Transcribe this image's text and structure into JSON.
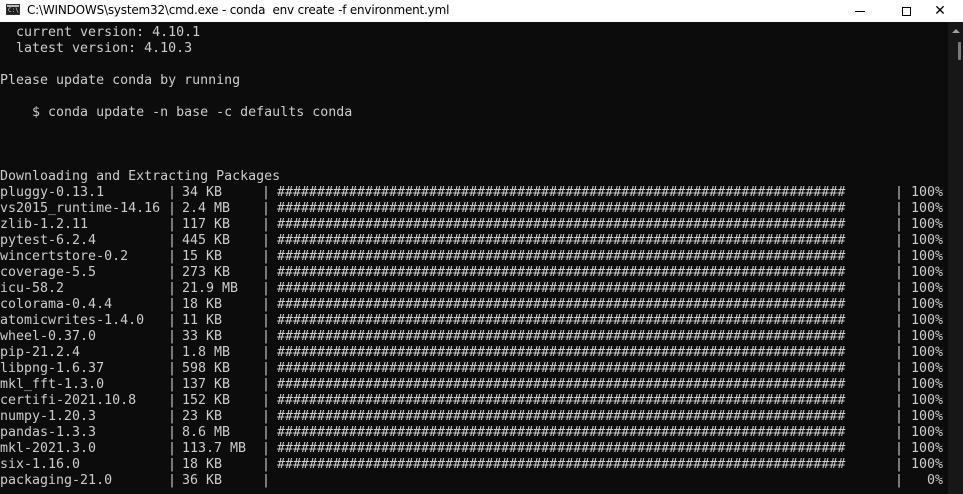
{
  "window": {
    "title": "C:\\WINDOWS\\system32\\cmd.exe - conda  env create -f environment.yml",
    "icon": "cmd-icon",
    "icon_text": "C:\\",
    "controls": {
      "minimize": "minimize-icon",
      "maximize": "maximize-icon",
      "close": "close-icon",
      "close_glyph": "✕"
    }
  },
  "console": {
    "header_lines": [
      "  current version: 4.10.1",
      "  latest version: 4.10.3",
      "",
      "Please update conda by running",
      "",
      "    $ conda update -n base -c defaults conda",
      "",
      "",
      "",
      "Downloading and Extracting Packages"
    ],
    "separator": "|",
    "progress_bar_full": "#######################################################################",
    "packages": [
      {
        "name": "pluggy-0.13.1",
        "size": "34 KB",
        "progress": 100,
        "percent": "100%"
      },
      {
        "name": "vs2015_runtime-14.16",
        "size": "2.4 MB",
        "progress": 100,
        "percent": "100%"
      },
      {
        "name": "zlib-1.2.11",
        "size": "117 KB",
        "progress": 100,
        "percent": "100%"
      },
      {
        "name": "pytest-6.2.4",
        "size": "445 KB",
        "progress": 100,
        "percent": "100%"
      },
      {
        "name": "wincertstore-0.2",
        "size": "15 KB",
        "progress": 100,
        "percent": "100%"
      },
      {
        "name": "coverage-5.5",
        "size": "273 KB",
        "progress": 100,
        "percent": "100%"
      },
      {
        "name": "icu-58.2",
        "size": "21.9 MB",
        "progress": 100,
        "percent": "100%"
      },
      {
        "name": "colorama-0.4.4",
        "size": "18 KB",
        "progress": 100,
        "percent": "100%"
      },
      {
        "name": "atomicwrites-1.4.0",
        "size": "11 KB",
        "progress": 100,
        "percent": "100%"
      },
      {
        "name": "wheel-0.37.0",
        "size": "33 KB",
        "progress": 100,
        "percent": "100%"
      },
      {
        "name": "pip-21.2.4",
        "size": "1.8 MB",
        "progress": 100,
        "percent": "100%"
      },
      {
        "name": "libpng-1.6.37",
        "size": "598 KB",
        "progress": 100,
        "percent": "100%"
      },
      {
        "name": "mkl_fft-1.3.0",
        "size": "137 KB",
        "progress": 100,
        "percent": "100%"
      },
      {
        "name": "certifi-2021.10.8",
        "size": "152 KB",
        "progress": 100,
        "percent": "100%"
      },
      {
        "name": "numpy-1.20.3",
        "size": "23 KB",
        "progress": 100,
        "percent": "100%"
      },
      {
        "name": "pandas-1.3.3",
        "size": "8.6 MB",
        "progress": 100,
        "percent": "100%"
      },
      {
        "name": "mkl-2021.3.0",
        "size": "113.7 MB",
        "progress": 100,
        "percent": "100%"
      },
      {
        "name": "six-1.16.0",
        "size": "18 KB",
        "progress": 100,
        "percent": "100%"
      },
      {
        "name": "packaging-21.0",
        "size": "36 KB",
        "progress": 0,
        "percent": "0%"
      }
    ]
  },
  "colors": {
    "background": "#0c0c0c",
    "foreground": "#cccccc",
    "titlebar": "#ffffff"
  }
}
